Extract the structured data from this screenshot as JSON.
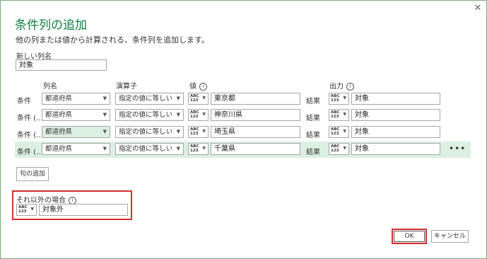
{
  "dialog": {
    "title": "条件列の追加",
    "description": "他の列または値から計算される、条件列を追加します。",
    "close_glyph": "✕"
  },
  "new_column": {
    "label": "新しい列名",
    "value": "対象"
  },
  "headers": {
    "column_name": "列名",
    "operator": "演算子",
    "value": "値",
    "output": "出力",
    "info_glyph": "i"
  },
  "rows": [
    {
      "label": "条件",
      "column": "都道府県",
      "operator": "指定の値に等しい",
      "type": "ABC\n123",
      "value": "東京都",
      "result": "結果",
      "output_type": "ABC\n123",
      "output": "対象"
    },
    {
      "label": "条件 (…",
      "column": "都道府県",
      "operator": "指定の値に等しい",
      "type": "ABC\n123",
      "value": "神奈川県",
      "result": "結果",
      "output_type": "ABC\n123",
      "output": "対象"
    },
    {
      "label": "条件 (…",
      "column": "都道府県",
      "operator": "指定の値に等しい",
      "type": "ABC\n123",
      "value": "埼玉県",
      "result": "結果",
      "output_type": "ABC\n123",
      "output": "対象"
    },
    {
      "label": "条件 (…",
      "column": "都道府県",
      "operator": "指定の値に等しい",
      "type": "ABC\n123",
      "value": "千葉県",
      "result": "結果",
      "output_type": "ABC\n123",
      "output": "対象"
    }
  ],
  "more_glyph": "•••",
  "add_clause_label": "句の追加",
  "else": {
    "label": "それ以外の場合",
    "type": "ABC\n123",
    "value": "対象外"
  },
  "buttons": {
    "ok": "OK",
    "cancel": "キャンセル"
  },
  "colors": {
    "title": "#107c41",
    "highlight": "#dcefe3",
    "emphasis_box": "#d32f2f"
  }
}
